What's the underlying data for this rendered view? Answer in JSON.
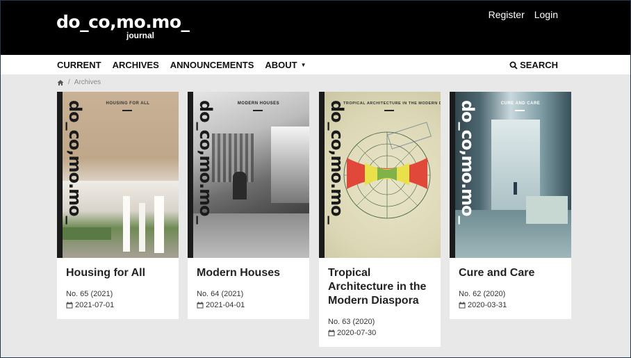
{
  "header": {
    "logo_text": "do_co,mo.mo_",
    "logo_sub": "journal",
    "register_label": "Register",
    "login_label": "Login"
  },
  "nav": {
    "items": [
      {
        "label": "CURRENT"
      },
      {
        "label": "ARCHIVES"
      },
      {
        "label": "ANNOUNCEMENTS"
      },
      {
        "label": "ABOUT"
      }
    ],
    "search_label": "SEARCH"
  },
  "breadcrumb": {
    "separator": "/",
    "current": "Archives"
  },
  "issues": [
    {
      "title": "Housing for All",
      "cover_title": "HOUSING FOR ALL",
      "cover_logo": "do_co,mo.mo_",
      "issue": "No. 65 (2021)",
      "date": "2021-07-01"
    },
    {
      "title": "Modern Houses",
      "cover_title": "MODERN HOUSES",
      "cover_logo": "do_co,mo.mo_",
      "issue": "No. 64 (2021)",
      "date": "2021-04-01"
    },
    {
      "title": "Tropical Architecture in the Modern Diaspora",
      "cover_title": "TROPICAL ARCHITECTURE IN THE MODERN DIASPORA",
      "cover_logo": "do_co,mo.mo_",
      "issue": "No. 63 (2020)",
      "date": "2020-07-30"
    },
    {
      "title": "Cure and Care",
      "cover_title": "CURE AND CARE",
      "cover_logo": "do_co,mo.mo_",
      "issue": "No. 62 (2020)",
      "date": "2020-03-31"
    }
  ]
}
